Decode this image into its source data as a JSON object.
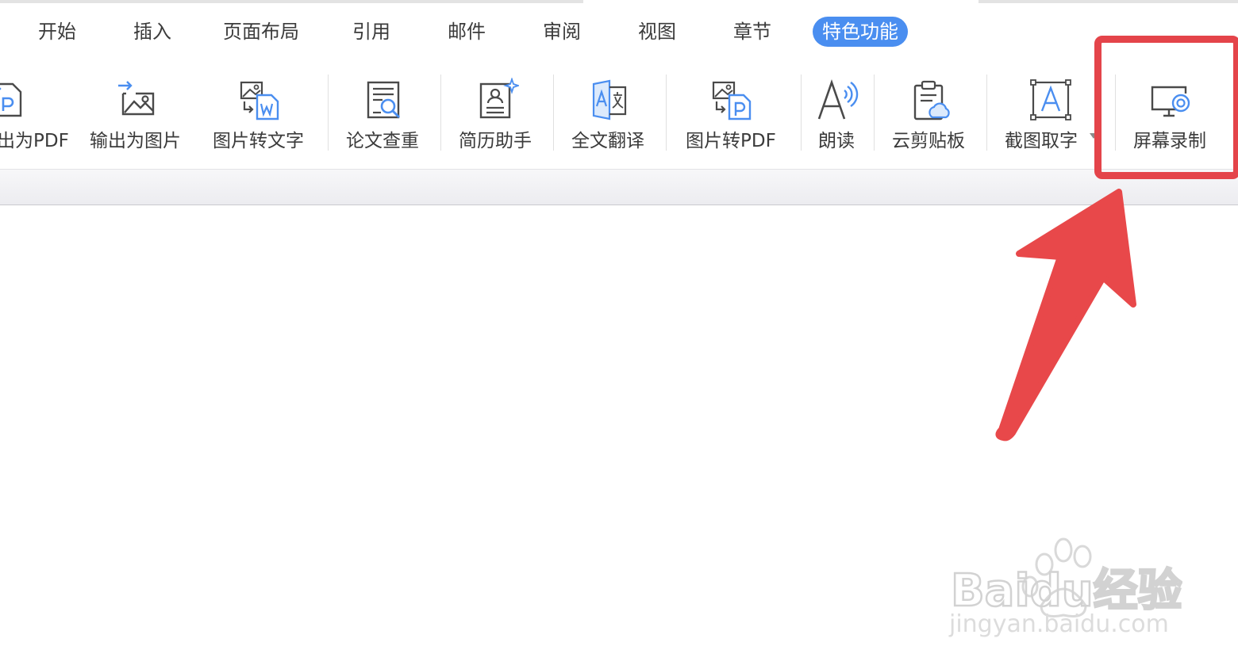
{
  "tabs": [
    "开始",
    "插入",
    "页面布局",
    "引用",
    "邮件",
    "审阅",
    "视图",
    "章节",
    "特色功能"
  ],
  "active_tab": "特色功能",
  "tools": [
    {
      "label": "出为PDF",
      "icon": "export-pdf-icon"
    },
    {
      "label": "输出为图片",
      "icon": "export-image-icon"
    },
    {
      "label": "图片转文字",
      "icon": "image-to-text-icon"
    },
    {
      "label": "论文查重",
      "icon": "paper-check-icon"
    },
    {
      "label": "简历助手",
      "icon": "resume-icon"
    },
    {
      "label": "全文翻译",
      "icon": "translate-icon"
    },
    {
      "label": "图片转PDF",
      "icon": "image-to-pdf-icon"
    },
    {
      "label": "朗读",
      "icon": "read-aloud-icon"
    },
    {
      "label": "云剪贴板",
      "icon": "cloud-clipboard-icon"
    },
    {
      "label": "截图取字",
      "icon": "screenshot-ocr-icon"
    },
    {
      "label": "屏幕录制",
      "icon": "screen-record-icon"
    }
  ],
  "watermark": {
    "brand": "Baidu经验",
    "url": "jingyan.baidu.com"
  },
  "colors": {
    "accent": "#4a8ef0",
    "highlight": "#e4444a",
    "icon_blue": "#4a8ef0",
    "icon_gray": "#4a4a4a"
  }
}
